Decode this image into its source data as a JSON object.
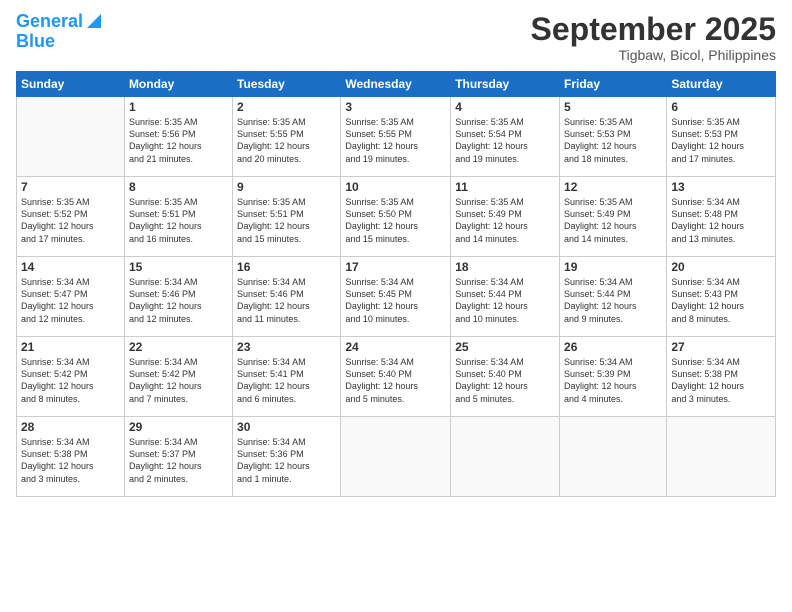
{
  "header": {
    "logo_line1": "General",
    "logo_line2": "Blue",
    "month": "September 2025",
    "location": "Tigbaw, Bicol, Philippines"
  },
  "weekdays": [
    "Sunday",
    "Monday",
    "Tuesday",
    "Wednesday",
    "Thursday",
    "Friday",
    "Saturday"
  ],
  "weeks": [
    [
      {
        "day": "",
        "info": ""
      },
      {
        "day": "1",
        "info": "Sunrise: 5:35 AM\nSunset: 5:56 PM\nDaylight: 12 hours\nand 21 minutes."
      },
      {
        "day": "2",
        "info": "Sunrise: 5:35 AM\nSunset: 5:55 PM\nDaylight: 12 hours\nand 20 minutes."
      },
      {
        "day": "3",
        "info": "Sunrise: 5:35 AM\nSunset: 5:55 PM\nDaylight: 12 hours\nand 19 minutes."
      },
      {
        "day": "4",
        "info": "Sunrise: 5:35 AM\nSunset: 5:54 PM\nDaylight: 12 hours\nand 19 minutes."
      },
      {
        "day": "5",
        "info": "Sunrise: 5:35 AM\nSunset: 5:53 PM\nDaylight: 12 hours\nand 18 minutes."
      },
      {
        "day": "6",
        "info": "Sunrise: 5:35 AM\nSunset: 5:53 PM\nDaylight: 12 hours\nand 17 minutes."
      }
    ],
    [
      {
        "day": "7",
        "info": "Sunrise: 5:35 AM\nSunset: 5:52 PM\nDaylight: 12 hours\nand 17 minutes."
      },
      {
        "day": "8",
        "info": "Sunrise: 5:35 AM\nSunset: 5:51 PM\nDaylight: 12 hours\nand 16 minutes."
      },
      {
        "day": "9",
        "info": "Sunrise: 5:35 AM\nSunset: 5:51 PM\nDaylight: 12 hours\nand 15 minutes."
      },
      {
        "day": "10",
        "info": "Sunrise: 5:35 AM\nSunset: 5:50 PM\nDaylight: 12 hours\nand 15 minutes."
      },
      {
        "day": "11",
        "info": "Sunrise: 5:35 AM\nSunset: 5:49 PM\nDaylight: 12 hours\nand 14 minutes."
      },
      {
        "day": "12",
        "info": "Sunrise: 5:35 AM\nSunset: 5:49 PM\nDaylight: 12 hours\nand 14 minutes."
      },
      {
        "day": "13",
        "info": "Sunrise: 5:34 AM\nSunset: 5:48 PM\nDaylight: 12 hours\nand 13 minutes."
      }
    ],
    [
      {
        "day": "14",
        "info": "Sunrise: 5:34 AM\nSunset: 5:47 PM\nDaylight: 12 hours\nand 12 minutes."
      },
      {
        "day": "15",
        "info": "Sunrise: 5:34 AM\nSunset: 5:46 PM\nDaylight: 12 hours\nand 12 minutes."
      },
      {
        "day": "16",
        "info": "Sunrise: 5:34 AM\nSunset: 5:46 PM\nDaylight: 12 hours\nand 11 minutes."
      },
      {
        "day": "17",
        "info": "Sunrise: 5:34 AM\nSunset: 5:45 PM\nDaylight: 12 hours\nand 10 minutes."
      },
      {
        "day": "18",
        "info": "Sunrise: 5:34 AM\nSunset: 5:44 PM\nDaylight: 12 hours\nand 10 minutes."
      },
      {
        "day": "19",
        "info": "Sunrise: 5:34 AM\nSunset: 5:44 PM\nDaylight: 12 hours\nand 9 minutes."
      },
      {
        "day": "20",
        "info": "Sunrise: 5:34 AM\nSunset: 5:43 PM\nDaylight: 12 hours\nand 8 minutes."
      }
    ],
    [
      {
        "day": "21",
        "info": "Sunrise: 5:34 AM\nSunset: 5:42 PM\nDaylight: 12 hours\nand 8 minutes."
      },
      {
        "day": "22",
        "info": "Sunrise: 5:34 AM\nSunset: 5:42 PM\nDaylight: 12 hours\nand 7 minutes."
      },
      {
        "day": "23",
        "info": "Sunrise: 5:34 AM\nSunset: 5:41 PM\nDaylight: 12 hours\nand 6 minutes."
      },
      {
        "day": "24",
        "info": "Sunrise: 5:34 AM\nSunset: 5:40 PM\nDaylight: 12 hours\nand 5 minutes."
      },
      {
        "day": "25",
        "info": "Sunrise: 5:34 AM\nSunset: 5:40 PM\nDaylight: 12 hours\nand 5 minutes."
      },
      {
        "day": "26",
        "info": "Sunrise: 5:34 AM\nSunset: 5:39 PM\nDaylight: 12 hours\nand 4 minutes."
      },
      {
        "day": "27",
        "info": "Sunrise: 5:34 AM\nSunset: 5:38 PM\nDaylight: 12 hours\nand 3 minutes."
      }
    ],
    [
      {
        "day": "28",
        "info": "Sunrise: 5:34 AM\nSunset: 5:38 PM\nDaylight: 12 hours\nand 3 minutes."
      },
      {
        "day": "29",
        "info": "Sunrise: 5:34 AM\nSunset: 5:37 PM\nDaylight: 12 hours\nand 2 minutes."
      },
      {
        "day": "30",
        "info": "Sunrise: 5:34 AM\nSunset: 5:36 PM\nDaylight: 12 hours\nand 1 minute."
      },
      {
        "day": "",
        "info": ""
      },
      {
        "day": "",
        "info": ""
      },
      {
        "day": "",
        "info": ""
      },
      {
        "day": "",
        "info": ""
      }
    ]
  ]
}
